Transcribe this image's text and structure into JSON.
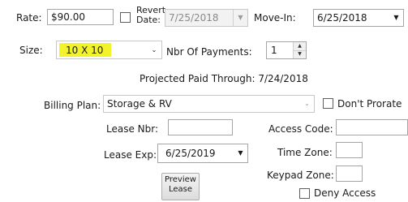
{
  "rate": {
    "label": "Rate:",
    "value": "$90.00"
  },
  "revert_date": {
    "label_line1": "Revert",
    "label_line2": "Date:",
    "value": "7/25/2018"
  },
  "move_in": {
    "label": "Move-In:",
    "value": "6/25/2018"
  },
  "size": {
    "label": "Size:",
    "value": "10 X 10",
    "highlight_color": "#f3f32c"
  },
  "payments": {
    "label": "Nbr Of Payments:",
    "value": "1"
  },
  "projected": {
    "text": "Projected Paid Through: 7/24/2018"
  },
  "billing_plan": {
    "label": "Billing Plan:",
    "value": "Storage & RV"
  },
  "dont_prorate": {
    "label": "Don't Prorate"
  },
  "lease_nbr": {
    "label": "Lease Nbr:",
    "value": ""
  },
  "access_code": {
    "label": "Access Code:",
    "value": ""
  },
  "lease_exp": {
    "label": "Lease Exp:",
    "value": "6/25/2019"
  },
  "time_zone": {
    "label": "Time Zone:",
    "value": ""
  },
  "keypad_zone": {
    "label": "Keypad Zone:",
    "value": ""
  },
  "deny_access": {
    "label": "Deny Access"
  },
  "preview_lease": {
    "label_line1": "Preview",
    "label_line2": "Lease"
  },
  "icons": {
    "dropdown": "chevron-down-icon",
    "spinner_up": "spin-up-icon",
    "spinner_down": "spin-down-icon"
  }
}
